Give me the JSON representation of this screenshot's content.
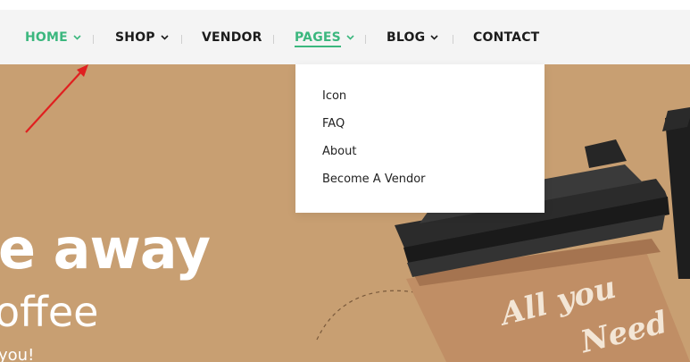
{
  "nav": {
    "items": [
      {
        "label": "HOME",
        "has_dropdown": true,
        "active": true
      },
      {
        "label": "SHOP",
        "has_dropdown": true,
        "active": false
      },
      {
        "label": "VENDOR",
        "has_dropdown": false,
        "active": false
      },
      {
        "label": "PAGES",
        "has_dropdown": true,
        "active": true
      },
      {
        "label": "BLOG",
        "has_dropdown": true,
        "active": false
      },
      {
        "label": "CONTACT",
        "has_dropdown": false,
        "active": false
      }
    ],
    "accent_color": "#3bb77e"
  },
  "dropdown": {
    "items": [
      "Icon",
      "FAQ",
      "About",
      "Become A Vendor"
    ]
  },
  "hero": {
    "headline_line1": "e away",
    "headline_line2": "offee",
    "tagline": "you!",
    "cup_text_line1": "All you",
    "cup_text_line2": "Need",
    "background_color": "#c89f72"
  },
  "annotation": {
    "arrow_color": "#e02020"
  }
}
